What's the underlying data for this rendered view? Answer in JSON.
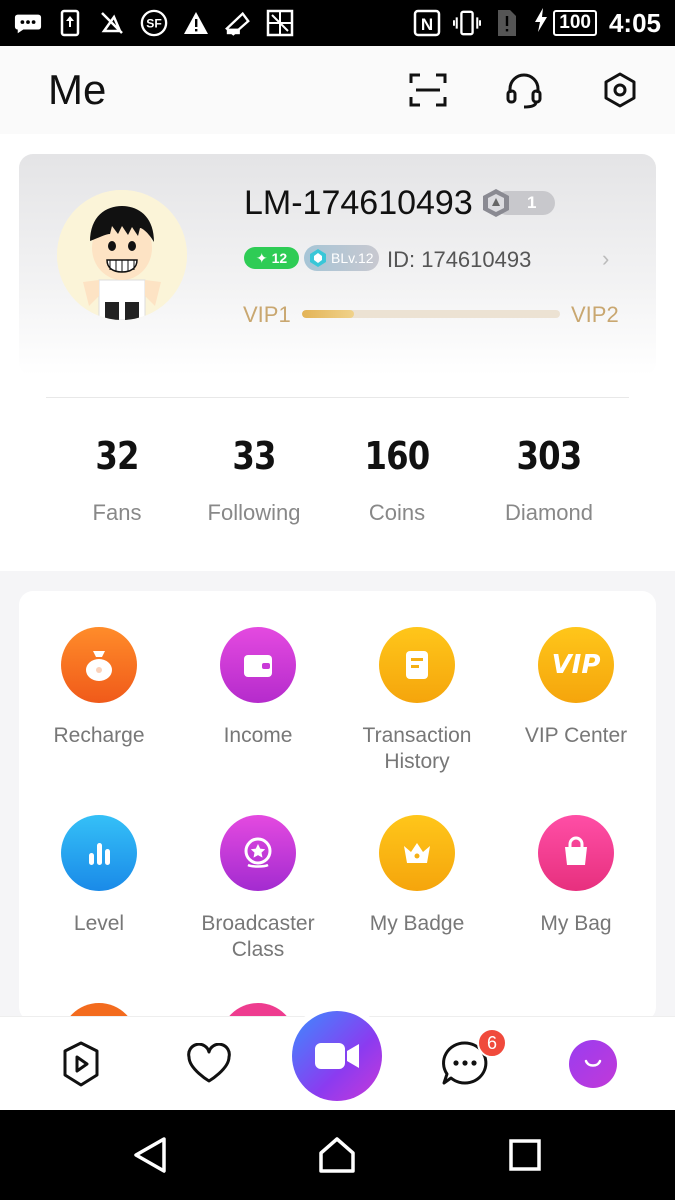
{
  "status_bar": {
    "battery": "100",
    "time": "4:05",
    "icons": [
      "chat-icon",
      "upload-icon",
      "muted-icon",
      "sf-icon",
      "warning-icon",
      "gallery-icon",
      "pattern-icon",
      "nfc-icon",
      "vibrate-icon",
      "sim-icon",
      "charging-icon"
    ]
  },
  "header": {
    "title": "Me",
    "actions": [
      "scan-icon",
      "headset-icon",
      "settings-icon"
    ]
  },
  "profile": {
    "username": "LM-174610493",
    "rank": "1",
    "level": "12",
    "broadcaster_level": "BLv.12",
    "id_text": "ID: 174610493",
    "vip_current": "VIP1",
    "vip_next": "VIP2",
    "vip_progress": 0.2
  },
  "stats": [
    {
      "value": "32",
      "label": "Fans"
    },
    {
      "value": "33",
      "label": "Following"
    },
    {
      "value": "160",
      "label": "Coins"
    },
    {
      "value": "303",
      "label": "Diamond"
    }
  ],
  "grid": [
    {
      "label": "Recharge",
      "icon": "moneybag-icon",
      "color": "#f36b1e"
    },
    {
      "label": "Income",
      "icon": "wallet-icon",
      "color": "#d03ad6"
    },
    {
      "label": "Transaction History",
      "icon": "receipt-icon",
      "color": "#f9b712"
    },
    {
      "label": "VIP Center",
      "icon": "vip-icon",
      "icon_text": "VIP",
      "color": "#f9b712"
    },
    {
      "label": "Level",
      "icon": "bars-icon",
      "color": "#22a8f0"
    },
    {
      "label": "Broadcaster Class",
      "icon": "medal-icon",
      "color": "#c33ad9"
    },
    {
      "label": "My Badge",
      "icon": "crown-icon",
      "color": "#f9b712"
    },
    {
      "label": "My Bag",
      "icon": "bag-icon",
      "color": "#ee3c8f"
    }
  ],
  "bottom_nav": {
    "items": [
      "play-icon",
      "heart-icon",
      "video-camera-icon",
      "message-icon",
      "smile-icon"
    ],
    "message_badge": "6"
  },
  "system_nav": [
    "back-icon",
    "home-icon",
    "recents-icon"
  ]
}
